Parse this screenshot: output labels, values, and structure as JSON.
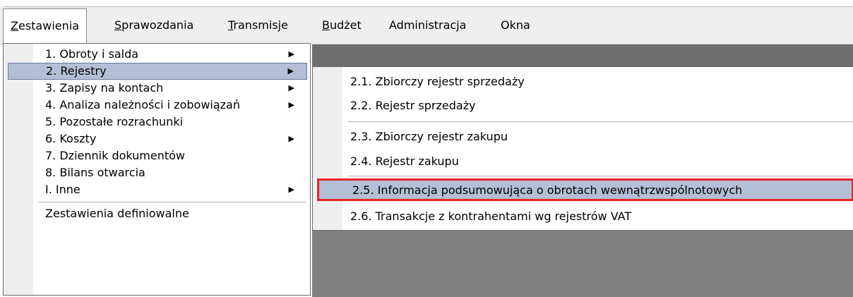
{
  "menubar": {
    "items": [
      {
        "label": "Zestawienia",
        "mnemonic_first": "Z",
        "rest": "estawienia"
      },
      {
        "label": "Sprawozdania",
        "mnemonic_first": "S",
        "rest": "prawozdania"
      },
      {
        "label": "Transmisje",
        "mnemonic_first": "T",
        "rest": "ransmisje"
      },
      {
        "label": "Budżet",
        "mnemonic_first": "B",
        "rest": "udżet"
      },
      {
        "label": "Administracja"
      },
      {
        "label": "Okna"
      }
    ]
  },
  "menu": {
    "items": [
      {
        "label": "1. Obroty i salda",
        "has_submenu": true
      },
      {
        "label": "2. Rejestry",
        "has_submenu": true,
        "selected": true
      },
      {
        "label": "3. Zapisy na kontach",
        "has_submenu": true
      },
      {
        "label": "4. Analiza należności i zobowiązań",
        "has_submenu": true
      },
      {
        "label": "5. Pozostałe rozrachunki",
        "has_submenu": false
      },
      {
        "label": "6. Koszty",
        "has_submenu": true
      },
      {
        "label": "7. Dziennik dokumentów",
        "has_submenu": false
      },
      {
        "label": "8. Bilans otwarcia",
        "has_submenu": false
      },
      {
        "label": "I. Inne",
        "has_submenu": true
      },
      {
        "label": "Zestawienia definiowalne",
        "has_submenu": false
      }
    ]
  },
  "submenu": {
    "items": [
      {
        "label": "2.1. Zbiorczy rejestr sprzedaży"
      },
      {
        "label": "2.2. Rejestr sprzedaży"
      },
      {
        "label": "2.3. Zbiorczy rejestr zakupu"
      },
      {
        "label": "2.4. Rejestr zakupu"
      },
      {
        "label": "2.5.  Informacja podsumowująca o obrotach wewnątrzwspólnotowych",
        "highlighted": true
      },
      {
        "label": "2.6. Transakcje z kontrahentami wg rejestrów VAT"
      }
    ]
  },
  "icons": {
    "submenu_arrow": "▶"
  },
  "colors": {
    "selection": "#b4bed6",
    "highlight_border": "#e8242a",
    "workspace": "#808080"
  }
}
